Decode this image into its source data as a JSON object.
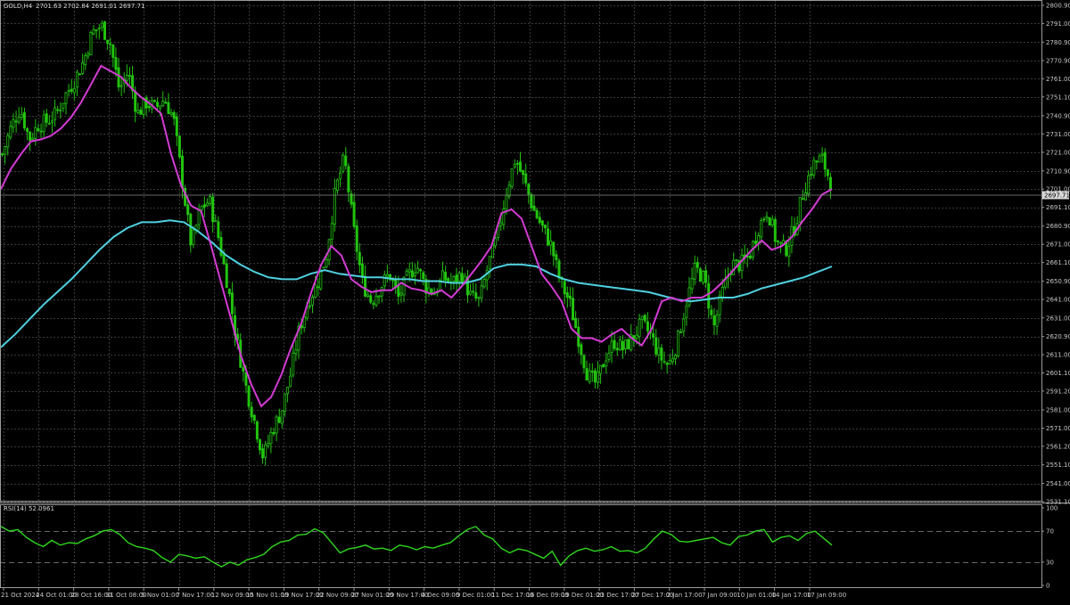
{
  "window": {
    "symbol_label": "GOLD,H4",
    "ohlc_label": "2701.63 2702.84 2691.01 2697.71"
  },
  "colors": {
    "background": "#000000",
    "bull_candle": "#22c40e",
    "ma_fast": "#d33bd3",
    "ma_slow": "#4fd0e0",
    "rsi_line": "#2ed61c",
    "price_tag_bg": "#d8d8d8",
    "grid": "#3a3a3a"
  },
  "chart_data": [
    {
      "type": "candlestick",
      "title": "GOLD,H4",
      "ylim": [
        2531.1,
        2800.9
      ],
      "grid": true,
      "y_tick_labels": [
        "2800.90",
        "2791.00",
        "2780.90",
        "2770.90",
        "2761.00",
        "2751.10",
        "2740.90",
        "2731.00",
        "2721.00",
        "2710.90",
        "2701.00",
        "2691.10",
        "2680.90",
        "2671.00",
        "2661.10",
        "2650.90",
        "2641.00",
        "2631.00",
        "2620.90",
        "2611.00",
        "2601.10",
        "2591.20",
        "2581.00",
        "2571.00",
        "2561.20",
        "2551.10",
        "2541.00",
        "2531.10"
      ],
      "current_price": "2697.71",
      "x_tick_labels": [
        "21 Oct 2024",
        "24 Oct 01:00",
        "28 Oct 16:00",
        "31 Oct 08:00",
        "5 Nov 01:00",
        "7 Nov 17:00",
        "12 Nov 09:00",
        "15 Nov 01:00",
        "19 Nov 17:00",
        "22 Nov 09:00",
        "27 Nov 01:00",
        "29 Nov 17:00",
        "4 Dec 09:00",
        "9 Dec 01:00",
        "11 Dec 17:00",
        "16 Dec 09:00",
        "19 Dec 01:00",
        "23 Dec 17:00",
        "27 Dec 17:00",
        "2 Jan 17:00",
        "7 Jan 09:00",
        "10 Jan 01:00",
        "14 Jan 17:00",
        "17 Jan 09:00"
      ],
      "close_path": [
        2720,
        2735,
        2745,
        2728,
        2736,
        2738,
        2742,
        2752,
        2760,
        2770,
        2786,
        2790,
        2780,
        2755,
        2765,
        2742,
        2748,
        2745,
        2750,
        2740,
        2705,
        2670,
        2690,
        2695,
        2675,
        2650,
        2620,
        2595,
        2575,
        2555,
        2570,
        2580,
        2600,
        2625,
        2640,
        2650,
        2665,
        2700,
        2718,
        2680,
        2650,
        2640,
        2648,
        2655,
        2642,
        2653,
        2660,
        2648,
        2645,
        2653,
        2650,
        2655,
        2643,
        2640,
        2660,
        2675,
        2700,
        2718,
        2705,
        2690,
        2680,
        2670,
        2650,
        2640,
        2620,
        2600,
        2595,
        2610,
        2618,
        2614,
        2620,
        2628,
        2622,
        2610,
        2605,
        2618,
        2640,
        2658,
        2652,
        2625,
        2645,
        2660,
        2660,
        2665,
        2680,
        2690,
        2672,
        2668,
        2680,
        2700,
        2714,
        2718,
        2705
      ],
      "series": [
        {
          "name": "MA fast",
          "values": [
            2701,
            2712,
            2720,
            2727,
            2728,
            2730,
            2734,
            2740,
            2748,
            2758,
            2768,
            2765,
            2762,
            2756,
            2751,
            2747,
            2742,
            2720,
            2703,
            2692,
            2689,
            2670,
            2650,
            2630,
            2610,
            2595,
            2583,
            2588,
            2600,
            2615,
            2628,
            2645,
            2660,
            2670,
            2665,
            2652,
            2648,
            2645,
            2646,
            2646,
            2650,
            2647,
            2646,
            2644,
            2646,
            2642,
            2648,
            2655,
            2662,
            2670,
            2688,
            2690,
            2685,
            2670,
            2655,
            2648,
            2640,
            2625,
            2620,
            2620,
            2618,
            2622,
            2625,
            2620,
            2616,
            2625,
            2640,
            2642,
            2640,
            2642,
            2642,
            2645,
            2650,
            2656,
            2662,
            2668,
            2673,
            2668,
            2670,
            2675,
            2683,
            2690,
            2698,
            2701
          ]
        },
        {
          "name": "MA slow",
          "values": [
            2615,
            2622,
            2630,
            2638,
            2645,
            2652,
            2660,
            2668,
            2675,
            2680,
            2683,
            2683,
            2684,
            2683,
            2678,
            2672,
            2665,
            2660,
            2656,
            2653,
            2652,
            2652,
            2655,
            2657,
            2655,
            2654,
            2653,
            2653,
            2652,
            2652,
            2651,
            2651,
            2650,
            2650,
            2652,
            2658,
            2660,
            2660,
            2659,
            2655,
            2652,
            2650,
            2649,
            2648,
            2647,
            2646,
            2645,
            2643,
            2641,
            2640,
            2641,
            2642,
            2642,
            2644,
            2647,
            2649,
            2651,
            2653,
            2656,
            2659
          ]
        }
      ]
    },
    {
      "type": "line",
      "title": "RSI(14) 52.0961",
      "ylim": [
        0,
        100
      ],
      "y_tick_labels": [
        "100",
        "70",
        "30",
        "0"
      ],
      "levels": [
        70,
        30
      ],
      "series": [
        {
          "name": "RSI(14)",
          "values": [
            76,
            70,
            72,
            62,
            55,
            50,
            58,
            52,
            55,
            54,
            60,
            64,
            70,
            72,
            66,
            55,
            50,
            48,
            45,
            36,
            30,
            40,
            38,
            35,
            37,
            30,
            24,
            30,
            26,
            33,
            36,
            40,
            50,
            56,
            58,
            65,
            66,
            73,
            68,
            55,
            42,
            47,
            49,
            52,
            47,
            48,
            45,
            52,
            50,
            46,
            50,
            48,
            52,
            55,
            64,
            72,
            76,
            65,
            60,
            48,
            42,
            47,
            45,
            40,
            35,
            44,
            26,
            38,
            45,
            48,
            44,
            46,
            50,
            44,
            45,
            42,
            48,
            60,
            70,
            66,
            57,
            56,
            58,
            60,
            62,
            55,
            52,
            63,
            65,
            70,
            72,
            56,
            62,
            64,
            58,
            67,
            70,
            61,
            52
          ]
        }
      ]
    }
  ]
}
